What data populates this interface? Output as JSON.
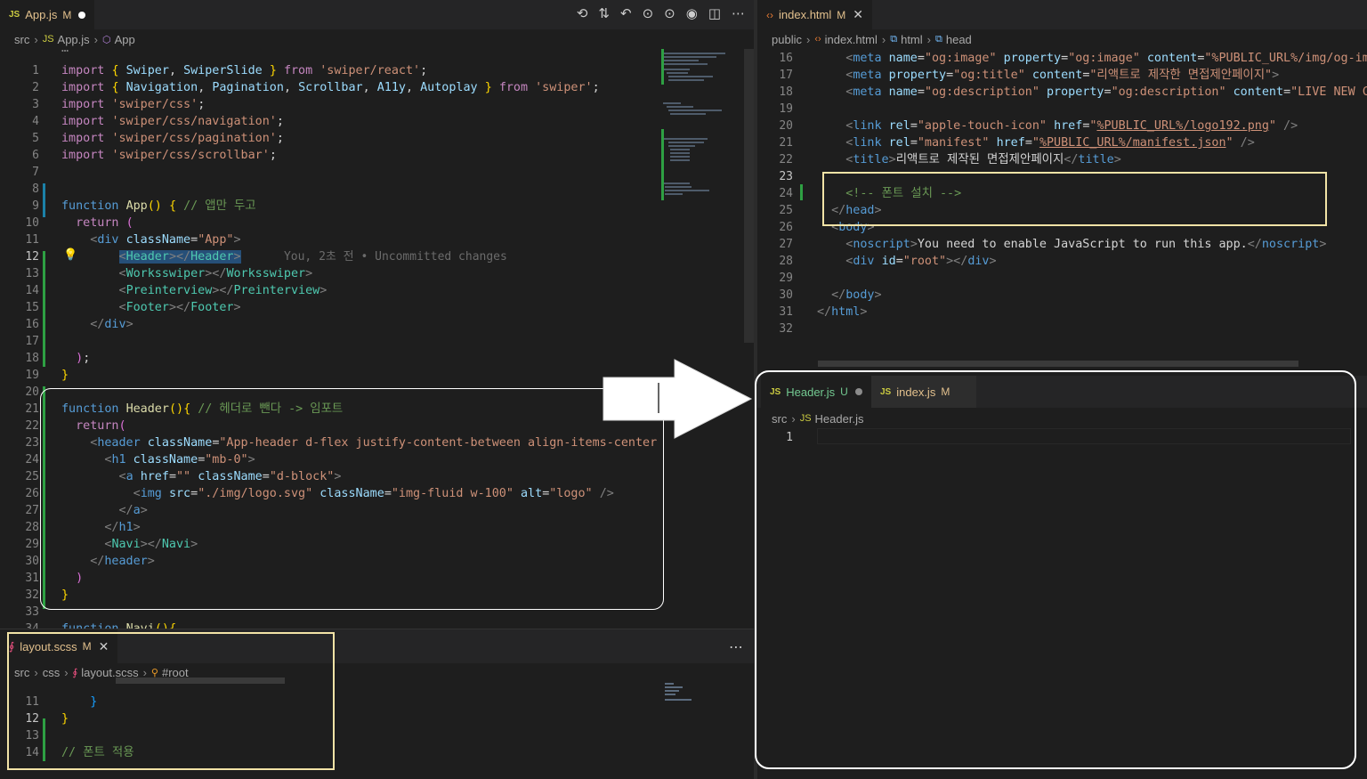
{
  "left_editor": {
    "tab": {
      "icon": "JS",
      "name": "App.js",
      "status": "M"
    },
    "toolbar_icons": [
      "history-icon",
      "compare-changes-icon",
      "go-back-icon",
      "go-forward-icon",
      "commit-icon",
      "git-icon",
      "split-editor-icon",
      "more-icon"
    ],
    "toolbar_glyphs": [
      "⟲",
      "⇅",
      "↶",
      "⊙",
      "⊙",
      "◉",
      "◫",
      "⋯"
    ],
    "breadcrumb": [
      "src",
      "App.js",
      "App"
    ],
    "fold_line": "…",
    "lines": [
      {
        "n": "1",
        "html": "<span class='ctl'>import</span> <span class='br1'>{</span> <span class='var'>Swiper</span>, <span class='var'>SwiperSlide</span> <span class='br1'>}</span> <span class='ctl'>from</span> <span class='str'>'swiper/react'</span>;"
      },
      {
        "n": "2",
        "html": "<span class='ctl'>import</span> <span class='br1'>{</span> <span class='var'>Navigation</span>, <span class='var'>Pagination</span>, <span class='var'>Scrollbar</span>, <span class='var'>A11y</span>, <span class='var'>Autoplay</span> <span class='br1'>}</span> <span class='ctl'>from</span> <span class='str'>'swiper'</span>;"
      },
      {
        "n": "3",
        "html": "<span class='ctl'>import</span> <span class='str'>'swiper/css'</span>;"
      },
      {
        "n": "4",
        "html": "<span class='ctl'>import</span> <span class='str'>'swiper/css/navigation'</span>;"
      },
      {
        "n": "5",
        "html": "<span class='ctl'>import</span> <span class='str'>'swiper/css/pagination'</span>;"
      },
      {
        "n": "6",
        "html": "<span class='ctl'>import</span> <span class='str'>'swiper/css/scrollbar'</span>;"
      },
      {
        "n": "7",
        "html": ""
      },
      {
        "n": "8",
        "html": ""
      },
      {
        "n": "9",
        "html": "<span class='kw'>function</span> <span class='fn'>App</span><span class='br1'>()</span> <span class='br1'>{</span> <span class='cm'>// 앱만 두고</span>"
      },
      {
        "n": "10",
        "html": "  <span class='ctl'>return</span> <span class='br2'>(</span>"
      },
      {
        "n": "11",
        "html": "    <span class='pu'>&lt;</span><span class='tag'>div</span> <span class='attr'>className</span>=<span class='str'>\"App\"</span><span class='pu'>&gt;</span>"
      },
      {
        "n": "12",
        "html": "        <span class='highlight-sel'><span class='pu'>&lt;</span><span class='comp'>Header</span><span class='pu'>&gt;&lt;/</span><span class='comp'>Header</span><span class='pu'>&gt;</span></span>      <span class='ghost'>You, 2초 전 • Uncommitted changes</span>"
      },
      {
        "n": "13",
        "html": "        <span class='pu'>&lt;</span><span class='comp'>Worksswiper</span><span class='pu'>&gt;&lt;/</span><span class='comp'>Worksswiper</span><span class='pu'>&gt;</span>"
      },
      {
        "n": "14",
        "html": "        <span class='pu'>&lt;</span><span class='comp'>Preinterview</span><span class='pu'>&gt;&lt;/</span><span class='comp'>Preinterview</span><span class='pu'>&gt;</span>"
      },
      {
        "n": "15",
        "html": "        <span class='pu'>&lt;</span><span class='comp'>Footer</span><span class='pu'>&gt;&lt;/</span><span class='comp'>Footer</span><span class='pu'>&gt;</span>"
      },
      {
        "n": "16",
        "html": "    <span class='pu'>&lt;/</span><span class='tag'>div</span><span class='pu'>&gt;</span>"
      },
      {
        "n": "17",
        "html": ""
      },
      {
        "n": "18",
        "html": "  <span class='br2'>)</span>;"
      },
      {
        "n": "19",
        "html": "<span class='br1'>}</span>"
      },
      {
        "n": "20",
        "html": ""
      },
      {
        "n": "21",
        "html": "<span class='kw'>function</span> <span class='fn'>Header</span><span class='br1'>()</span><span class='br1'>{</span> <span class='cm'>// 헤더로 뺀다 -&gt; 임포트</span>"
      },
      {
        "n": "22",
        "html": "  <span class='ctl'>return</span><span class='br2'>(</span>"
      },
      {
        "n": "23",
        "html": "    <span class='pu'>&lt;</span><span class='tag'>header</span> <span class='attr'>className</span>=<span class='str'>\"App-header d-flex justify-content-between align-items-center px-</span>"
      },
      {
        "n": "24",
        "html": "      <span class='pu'>&lt;</span><span class='tag'>h1</span> <span class='attr'>className</span>=<span class='str'>\"mb-0\"</span><span class='pu'>&gt;</span>"
      },
      {
        "n": "25",
        "html": "        <span class='pu'>&lt;</span><span class='tag'>a</span> <span class='attr'>href</span>=<span class='str'>\"\"</span> <span class='attr'>className</span>=<span class='str'>\"d-block\"</span><span class='pu'>&gt;</span>"
      },
      {
        "n": "26",
        "html": "          <span class='pu'>&lt;</span><span class='tag'>img</span> <span class='attr'>src</span>=<span class='str'>\"./img/logo.svg\"</span> <span class='attr'>className</span>=<span class='str'>\"img-fluid w-100\"</span> <span class='attr'>alt</span>=<span class='str'>\"logo\"</span> <span class='pu'>/&gt;</span>"
      },
      {
        "n": "27",
        "html": "        <span class='pu'>&lt;/</span><span class='tag'>a</span><span class='pu'>&gt;</span>"
      },
      {
        "n": "28",
        "html": "      <span class='pu'>&lt;/</span><span class='tag'>h1</span><span class='pu'>&gt;</span>"
      },
      {
        "n": "29",
        "html": "      <span class='pu'>&lt;</span><span class='comp'>Navi</span><span class='pu'>&gt;&lt;/</span><span class='comp'>Navi</span><span class='pu'>&gt;</span>"
      },
      {
        "n": "30",
        "html": "    <span class='pu'>&lt;/</span><span class='tag'>header</span><span class='pu'>&gt;</span>"
      },
      {
        "n": "31",
        "html": "  <span class='br2'>)</span>"
      },
      {
        "n": "32",
        "html": "<span class='br1'>}</span>"
      },
      {
        "n": "33",
        "html": ""
      },
      {
        "n": "34",
        "html": "<span class='kw'>function</span> <span class='fn'>Navi</span><span class='br1'>()</span><span class='br1'>{</span><span class='pu'>…</span>"
      }
    ]
  },
  "bottom_left_editor": {
    "tab": {
      "name": "layout.scss",
      "status": "M"
    },
    "more": "⋯",
    "breadcrumb": [
      "src",
      "css",
      "layout.scss",
      "#root"
    ],
    "lines": [
      {
        "n": "11",
        "html": "    <span class='br3'>}</span>"
      },
      {
        "n": "12",
        "html": "<span class='br1'>}</span>"
      },
      {
        "n": "13",
        "html": ""
      },
      {
        "n": "14",
        "html": "<span class='cm'>// 폰트 적용</span>"
      }
    ]
  },
  "right_top_editor": {
    "tab": {
      "name": "index.html",
      "status": "M"
    },
    "breadcrumb": [
      "public",
      "index.html",
      "html",
      "head"
    ],
    "lines": [
      {
        "n": "16",
        "html": "    <span class='pu'>&lt;</span><span class='tag'>meta</span> <span class='attr'>name</span>=<span class='str'>\"og:image\"</span> <span class='attr'>property</span>=<span class='str'>\"og:image\"</span> <span class='attr'>content</span>=<span class='str'>\"%PUBLIC_URL%/img/og-image</span>"
      },
      {
        "n": "17",
        "html": "    <span class='pu'>&lt;</span><span class='tag'>meta</span> <span class='attr'>property</span>=<span class='str'>\"og:title\"</span> <span class='attr'>content</span>=<span class='str'>\"리액트로 제작한 면접제안페이지\"</span><span class='pu'>&gt;</span>"
      },
      {
        "n": "18",
        "html": "    <span class='pu'>&lt;</span><span class='tag'>meta</span> <span class='attr'>name</span>=<span class='str'>\"og:description\"</span> <span class='attr'>property</span>=<span class='str'>\"og:description\"</span> <span class='attr'>content</span>=<span class='str'>\"LIVE NEW CJ\"/</span>"
      },
      {
        "n": "19",
        "html": ""
      },
      {
        "n": "20",
        "html": "    <span class='pu'>&lt;</span><span class='tag'>link</span> <span class='attr'>rel</span>=<span class='str'>\"apple-touch-icon\"</span> <span class='attr'>href</span>=<span class='str'>\"<u>%PUBLIC_URL%/logo192.png</u>\"</span> <span class='pu'>/&gt;</span>"
      },
      {
        "n": "21",
        "html": "    <span class='pu'>&lt;</span><span class='tag'>link</span> <span class='attr'>rel</span>=<span class='str'>\"manifest\"</span> <span class='attr'>href</span>=<span class='str'>\"<u>%PUBLIC_URL%/manifest.json</u>\"</span> <span class='pu'>/&gt;</span>"
      },
      {
        "n": "22",
        "html": "    <span class='pu'>&lt;</span><span class='tag'>title</span><span class='pu'>&gt;</span><span class='plain'>리액트로 제작된 면접제안페이지</span><span class='pu'>&lt;/</span><span class='tag'>title</span><span class='pu'>&gt;</span>"
      },
      {
        "n": "23",
        "html": ""
      },
      {
        "n": "24",
        "html": "    <span class='cm'>&lt;!-- 폰트 설치 --&gt;</span>"
      },
      {
        "n": "25",
        "html": "  <span class='pu'>&lt;/</span><span class='tag'>head</span><span class='pu'>&gt;</span>"
      },
      {
        "n": "26",
        "html": "  <span class='pu'>&lt;</span><span class='tag'>body</span><span class='pu'>&gt;</span>"
      },
      {
        "n": "27",
        "html": "    <span class='pu'>&lt;</span><span class='tag'>noscript</span><span class='pu'>&gt;</span><span class='plain'>You need to enable JavaScript to run this app.</span><span class='pu'>&lt;/</span><span class='tag'>noscript</span><span class='pu'>&gt;</span>"
      },
      {
        "n": "28",
        "html": "    <span class='pu'>&lt;</span><span class='tag'>div</span> <span class='attr'>id</span>=<span class='str'>\"root\"</span><span class='pu'>&gt;&lt;/</span><span class='tag'>div</span><span class='pu'>&gt;</span>"
      },
      {
        "n": "29",
        "html": ""
      },
      {
        "n": "30",
        "html": "  <span class='pu'>&lt;/</span><span class='tag'>body</span><span class='pu'>&gt;</span>"
      },
      {
        "n": "31",
        "html": "<span class='pu'>&lt;/</span><span class='tag'>html</span><span class='pu'>&gt;</span>"
      },
      {
        "n": "32",
        "html": ""
      }
    ]
  },
  "right_bottom_editor": {
    "tabs": [
      {
        "name": "Header.js",
        "status": "U"
      },
      {
        "name": "index.js",
        "status": "M"
      }
    ],
    "breadcrumb": [
      "src",
      "Header.js"
    ],
    "lines": [
      {
        "n": "1",
        "html": ""
      }
    ]
  },
  "arrow": "right-arrow"
}
